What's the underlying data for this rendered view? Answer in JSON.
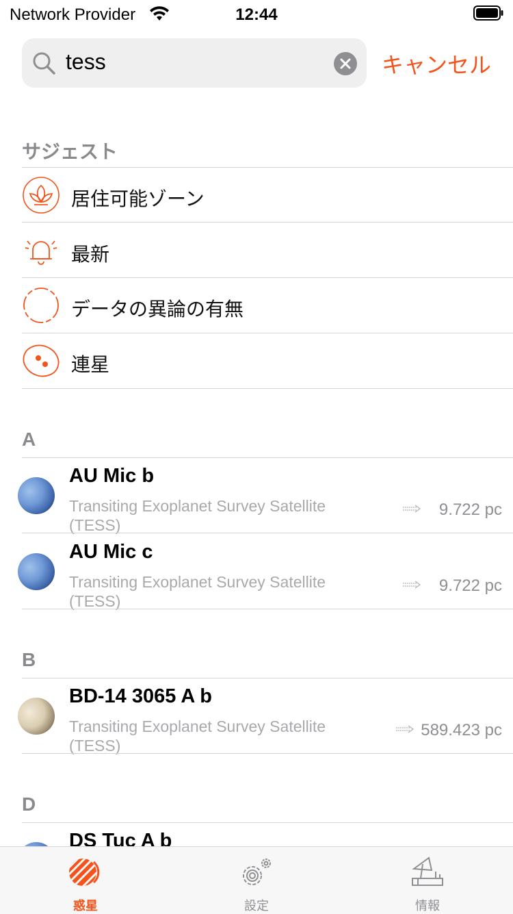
{
  "status_bar": {
    "carrier": "Network Provider",
    "time": "12:44"
  },
  "search": {
    "query": "tess",
    "cancel_label": "キャンセル"
  },
  "suggestions": {
    "header": "サジェスト",
    "items": [
      {
        "label": "居住可能ゾーン",
        "icon": "leaf-icon"
      },
      {
        "label": "最新",
        "icon": "bell-icon"
      },
      {
        "label": "データの異論の有無",
        "icon": "dashed-circle-icon"
      },
      {
        "label": "連星",
        "icon": "binary-star-icon"
      }
    ]
  },
  "sections": [
    {
      "letter": "A",
      "planets": [
        {
          "name": "AU Mic b",
          "mission": "Transiting Exoplanet Survey Satellite (TESS)",
          "distance": "9.722 pc"
        },
        {
          "name": "AU Mic c",
          "mission": "Transiting Exoplanet Survey Satellite (TESS)",
          "distance": "9.722 pc"
        }
      ]
    },
    {
      "letter": "B",
      "planets": [
        {
          "name": "BD-14 3065 A b",
          "mission": "Transiting Exoplanet Survey Satellite (TESS)",
          "distance": "589.423 pc"
        }
      ]
    },
    {
      "letter": "D",
      "planets": [
        {
          "name": "DS Tuc A b",
          "mission": "",
          "distance": ""
        }
      ]
    }
  ],
  "tabs": [
    {
      "label": "惑星",
      "icon": "planet-icon",
      "active": true
    },
    {
      "label": "設定",
      "icon": "gear-icon",
      "active": false
    },
    {
      "label": "情報",
      "icon": "satellite-dish-icon",
      "active": false
    }
  ],
  "colors": {
    "accent": "#f2541b",
    "secondary_text": "#8e8e93"
  }
}
